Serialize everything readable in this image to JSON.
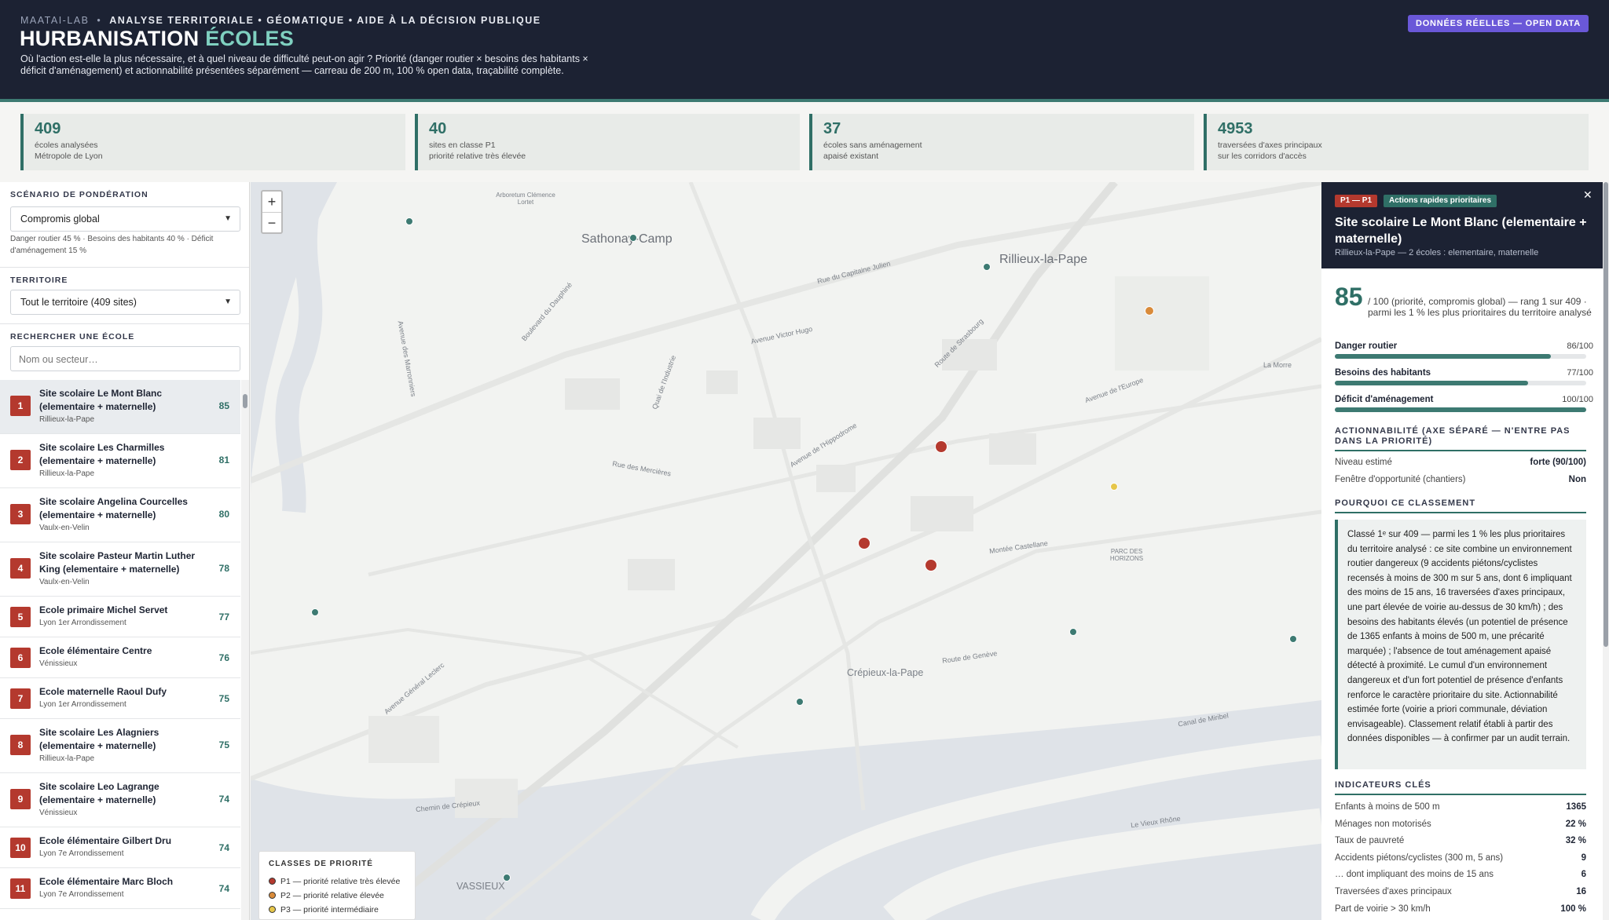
{
  "header": {
    "brand": "MAATAI-LAB",
    "tagline": "ANALYSE TERRITORIALE • GÉOMATIQUE • AIDE À LA DÉCISION PUBLIQUE",
    "title_main": "HURBANISATION",
    "title_accent": "ÉCOLES",
    "description": "Où l'action est-elle la plus nécessaire, et à quel niveau de difficulté peut-on agir ? Priorité (danger routier × besoins des habitants × déficit d'aménagement) et actionnabilité présentées séparément — carreau de 200 m, 100 % open data, traçabilité complète.",
    "badge": "DONNÉES RÉELLES — OPEN DATA"
  },
  "kpis": [
    {
      "value": "409",
      "line1": "écoles analysées",
      "line2": "Métropole de Lyon"
    },
    {
      "value": "40",
      "line1": "sites en classe P1",
      "line2": "priorité relative très élevée"
    },
    {
      "value": "37",
      "line1": "écoles sans aménagement",
      "line2": "apaisé existant"
    },
    {
      "value": "4953",
      "line1": "traversées d'axes principaux",
      "line2": "sur les corridors d'accès"
    }
  ],
  "sidebar": {
    "weighting_heading": "SCÉNARIO DE PONDÉRATION",
    "weighting_value": "Compromis global",
    "weighting_desc": "Danger routier 45 % · Besoins des habitants 40 % · Déficit d'aménagement 15 %",
    "territory_heading": "TERRITOIRE",
    "territory_value": "Tout le territoire (409 sites)",
    "search_heading": "RECHERCHER UNE ÉCOLE",
    "search_placeholder": "Nom ou secteur…",
    "schools": [
      {
        "rank": "1",
        "name": "Site scolaire Le Mont Blanc (elementaire + maternelle)",
        "commune": "Rillieux-la-Pape",
        "score": "85"
      },
      {
        "rank": "2",
        "name": "Site scolaire Les Charmilles (elementaire + maternelle)",
        "commune": "Rillieux-la-Pape",
        "score": "81"
      },
      {
        "rank": "3",
        "name": "Site scolaire Angelina Courcelles (elementaire + maternelle)",
        "commune": "Vaulx-en-Velin",
        "score": "80"
      },
      {
        "rank": "4",
        "name": "Site scolaire Pasteur Martin Luther King (elementaire + maternelle)",
        "commune": "Vaulx-en-Velin",
        "score": "78"
      },
      {
        "rank": "5",
        "name": "Ecole primaire Michel Servet",
        "commune": "Lyon 1er Arrondissement",
        "score": "77"
      },
      {
        "rank": "6",
        "name": "Ecole élémentaire Centre",
        "commune": "Vénissieux",
        "score": "76"
      },
      {
        "rank": "7",
        "name": "Ecole maternelle Raoul Dufy",
        "commune": "Lyon 1er Arrondissement",
        "score": "75"
      },
      {
        "rank": "8",
        "name": "Site scolaire Les Alagniers (elementaire + maternelle)",
        "commune": "Rillieux-la-Pape",
        "score": "75"
      },
      {
        "rank": "9",
        "name": "Site scolaire Leo Lagrange (elementaire + maternelle)",
        "commune": "Vénissieux",
        "score": "74"
      },
      {
        "rank": "10",
        "name": "Ecole élémentaire Gilbert Dru",
        "commune": "Lyon 7e Arrondissement",
        "score": "74"
      },
      {
        "rank": "11",
        "name": "Ecole élémentaire Marc Bloch",
        "commune": "Lyon 7e Arrondissement",
        "score": "74"
      }
    ]
  },
  "map": {
    "zoom_in": "+",
    "zoom_out": "−",
    "labels": {
      "sathonay": "Sathonay-Camp",
      "rillieux": "Rillieux-la-Pape",
      "crepieux": "Crépieux-la-Pape",
      "vassieux": "VASSIEUX",
      "arboretum": "Arboretum Clémence Lortet",
      "parc": "PARC DES HORIZONS",
      "lamore": "La Morre",
      "rue_capitaine": "Rue du Capitaine Julien",
      "av_hugo": "Avenue Victor Hugo",
      "rte_strasbourg": "Route de Strasbourg",
      "av_europe": "Avenue de l'Europe",
      "av_hippodrome": "Avenue de l'Hippodrome",
      "rte_geneve": "Route de Genève",
      "canal": "Canal de Miribel",
      "av_leclerc": "Avenue Général Leclerc",
      "ch_crepieux": "Chemin de Crépieux",
      "montee_castellane": "Montée Castellane",
      "vieux_rhone": "Le Vieux Rhône",
      "quai": "Quai de l'Industrie",
      "av_marronniers": "Avenue des Marronniers",
      "bd_dauphine": "Boulevard du Dauphiné",
      "rue_mercieres": "Rue des Mercières"
    },
    "markers": [
      {
        "cls": "P1",
        "color": "#b4392e"
      },
      {
        "cls": "P1",
        "color": "#b4392e"
      },
      {
        "cls": "P1",
        "color": "#b4392e"
      },
      {
        "cls": "P2",
        "color": "#d98b3a"
      },
      {
        "cls": "P3",
        "color": "#e6c64a"
      },
      {
        "cls": "other",
        "color": "#3d7a72"
      }
    ],
    "legend": {
      "title": "CLASSES DE PRIORITÉ",
      "items": [
        {
          "label": "P1 — priorité relative très élevée",
          "color": "#b4392e"
        },
        {
          "label": "P2 — priorité relative élevée",
          "color": "#d98b3a"
        },
        {
          "label": "P3 — priorité intermédiaire",
          "color": "#e6c64a"
        }
      ]
    }
  },
  "panel": {
    "badge_class": "P1 — P1",
    "badge_class_color": "#b4392e",
    "badge_action": "Actions rapides prioritaires",
    "badge_action_color": "#2f6f66",
    "name": "Site scolaire Le Mont Blanc (elementaire + maternelle)",
    "location": "Rillieux-la-Pape — 2 écoles : elementaire, maternelle",
    "score": "85",
    "score_text": "/ 100 (priorité, compromis global) — rang 1 sur 409 · parmi les 1 % les plus prioritaires du territoire analysé",
    "bars": [
      {
        "label": "Danger routier",
        "value": "86/100",
        "fraction": 0.86
      },
      {
        "label": "Besoins des habitants",
        "value": "77/100",
        "fraction": 0.77
      },
      {
        "label": "Déficit d'aménagement",
        "value": "100/100",
        "fraction": 1.0
      }
    ],
    "action_heading": "ACTIONNABILITÉ (AXE SÉPARÉ — N'ENTRE PAS DANS LA PRIORITÉ)",
    "action_rows": [
      {
        "label": "Niveau estimé",
        "value": "forte (90/100)"
      },
      {
        "label": "Fenêtre d'opportunité (chantiers)",
        "value": "Non"
      }
    ],
    "why_heading": "POURQUOI CE CLASSEMENT",
    "why_text": "Classé 1ᵉ sur 409 — parmi les 1 % les plus prioritaires du territoire analysé : ce site combine un environnement routier dangereux (9 accidents piétons/cyclistes recensés à moins de 300 m sur 5 ans, dont 6 impliquant des moins de 15 ans, 16 traversées d'axes principaux, une part élevée de voirie au-dessus de 30 km/h) ; des besoins des habitants élevés (un potentiel de présence de 1365 enfants à moins de 500 m, une précarité marquée) ; l'absence de tout aménagement apaisé détecté à proximité. Le cumul d'un environnement dangereux et d'un fort potentiel de présence d'enfants renforce le caractère prioritaire du site. Actionnabilité estimée forte (voirie a priori communale, déviation envisageable). Classement relatif établi à partir des données disponibles — à confirmer par un audit terrain.",
    "kpi_heading": "INDICATEURS CLÉS",
    "indicators": [
      {
        "label": "Enfants à moins de 500 m",
        "value": "1365"
      },
      {
        "label": "Ménages non motorisés",
        "value": "22 %"
      },
      {
        "label": "Taux de pauvreté",
        "value": "32 %"
      },
      {
        "label": "Accidents piétons/cyclistes (300 m, 5 ans)",
        "value": "9"
      },
      {
        "label": "… dont impliquant des moins de 15 ans",
        "value": "6"
      },
      {
        "label": "Traversées d'axes principaux",
        "value": "16"
      },
      {
        "label": "Part de voirie > 30 km/h",
        "value": "100 %"
      }
    ]
  }
}
